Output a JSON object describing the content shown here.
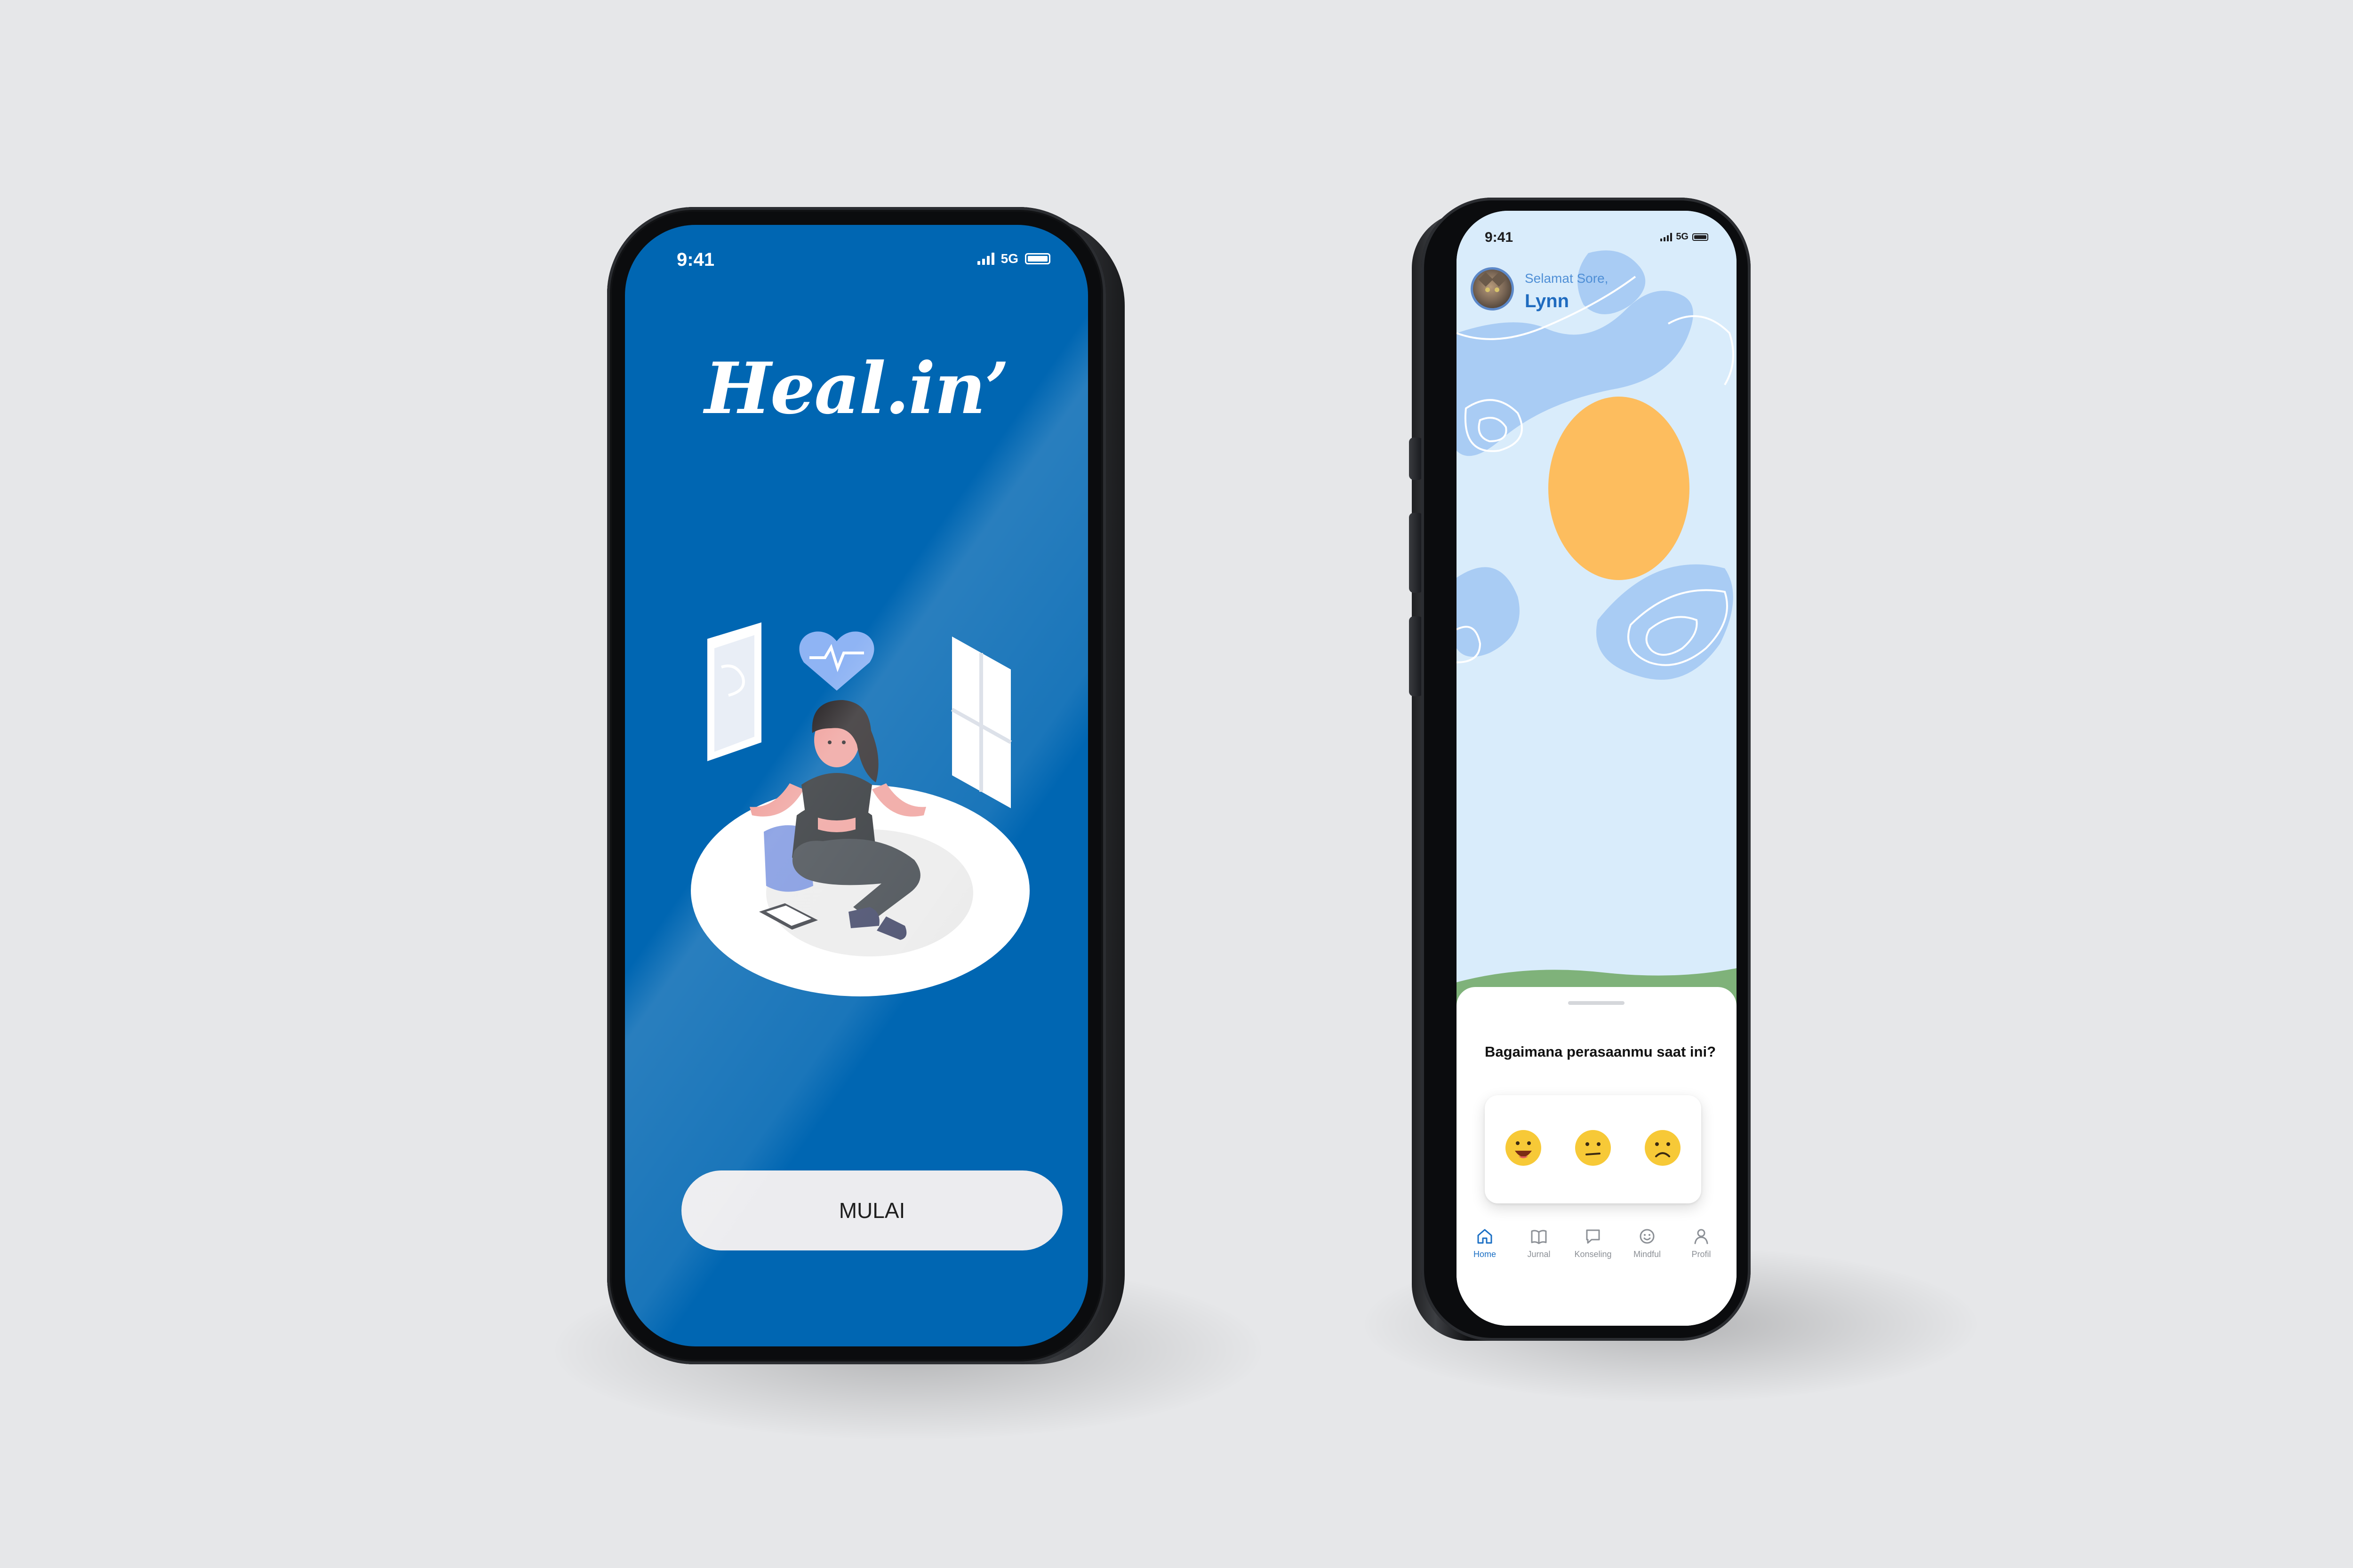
{
  "colors": {
    "background": "#e6e7e9",
    "splash_blue": "#0066b2",
    "home_sky": "#d9ecfb",
    "accent_blue": "#1b6fc4",
    "sun": "#fdbd5e"
  },
  "splash": {
    "status_time": "9:41",
    "status_network": "5G",
    "logo": "Heal.in’",
    "start_button": "MULAI"
  },
  "home": {
    "status_time": "9:41",
    "status_network": "5G",
    "greeting": "Selamat Sore,",
    "user_name": "Lynn",
    "mood_question": "Bagaimana perasaanmu saat ini?",
    "moods": [
      "happy-face-icon",
      "neutral-face-icon",
      "sad-face-icon"
    ],
    "nav": [
      {
        "label": "Home",
        "icon": "home-icon",
        "active": true
      },
      {
        "label": "Jurnal",
        "icon": "book-icon",
        "active": false
      },
      {
        "label": "Konseling",
        "icon": "chat-icon",
        "active": false
      },
      {
        "label": "Mindful",
        "icon": "smile-icon",
        "active": false
      },
      {
        "label": "Profil",
        "icon": "person-icon",
        "active": false
      }
    ]
  }
}
